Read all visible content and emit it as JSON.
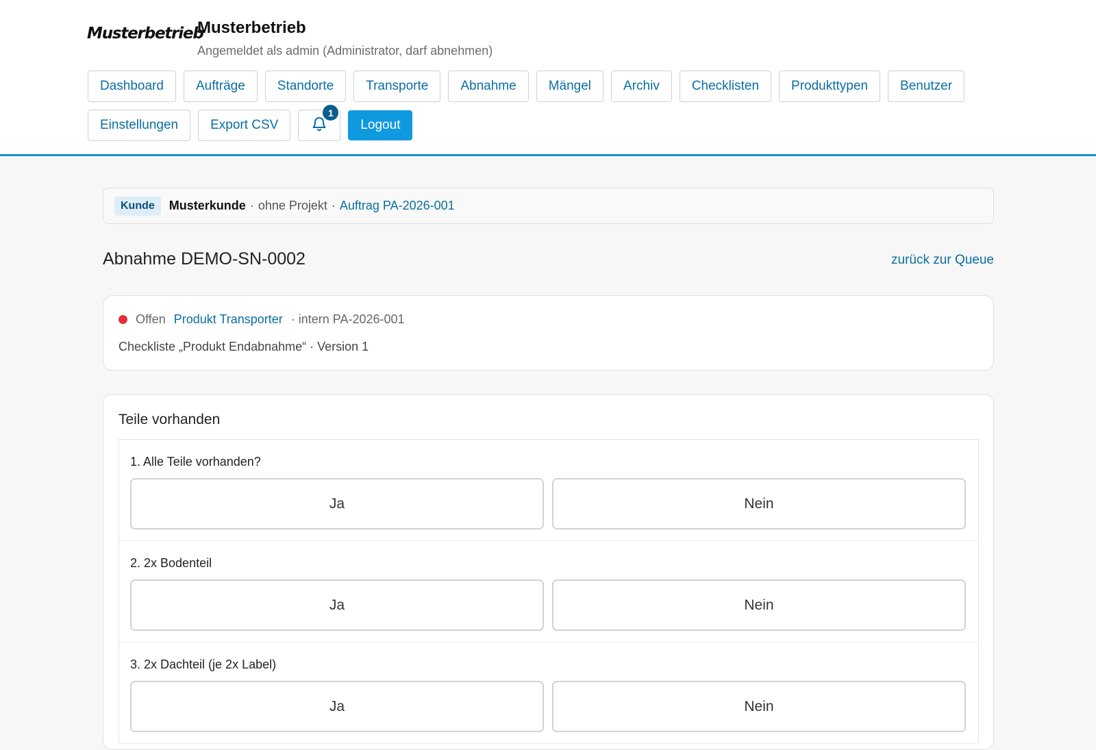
{
  "brand": {
    "logo_text": "Musterbetrieb",
    "title": "Musterbetrieb",
    "subtitle": "Angemeldet als admin (Administrator, darf abnehmen)"
  },
  "nav": {
    "dashboard": "Dashboard",
    "auftraege": "Aufträge",
    "standorte": "Standorte",
    "transporte": "Transporte",
    "abnahme": "Abnahme",
    "maengel": "Mängel",
    "archiv": "Archiv",
    "checklisten": "Checklisten",
    "produkttypen": "Produkttypen",
    "benutzer": "Benutzer",
    "einstellungen": "Einstellungen",
    "export_csv": "Export CSV",
    "notification_count": "1",
    "logout": "Logout"
  },
  "breadcrumb": {
    "tag": "Kunde",
    "customer": "Musterkunde",
    "sep1": "·",
    "project": "ohne Projekt",
    "sep2": "·",
    "order_link": "Auftrag PA-2026-001"
  },
  "page": {
    "title": "Abnahme DEMO-SN-0002",
    "back_link": "zurück zur Queue"
  },
  "info": {
    "status": "Offen",
    "status_color": "#e0303b",
    "product": "Produkt Transporter",
    "internal": "· intern PA-2026-001",
    "checklist": "Checkliste „Produkt Endabnahme“ · Version 1"
  },
  "section": {
    "title": "Teile vorhanden",
    "items": [
      {
        "label": "1. Alle Teile vorhanden?",
        "yes": "Ja",
        "no": "Nein"
      },
      {
        "label": "2. 2x Bodenteil",
        "yes": "Ja",
        "no": "Nein"
      },
      {
        "label": "3. 2x Dachteil (je 2x Label)",
        "yes": "Ja",
        "no": "Nein"
      }
    ]
  },
  "colors": {
    "accent": "#0f9ae0",
    "link": "#0a6ea3"
  }
}
